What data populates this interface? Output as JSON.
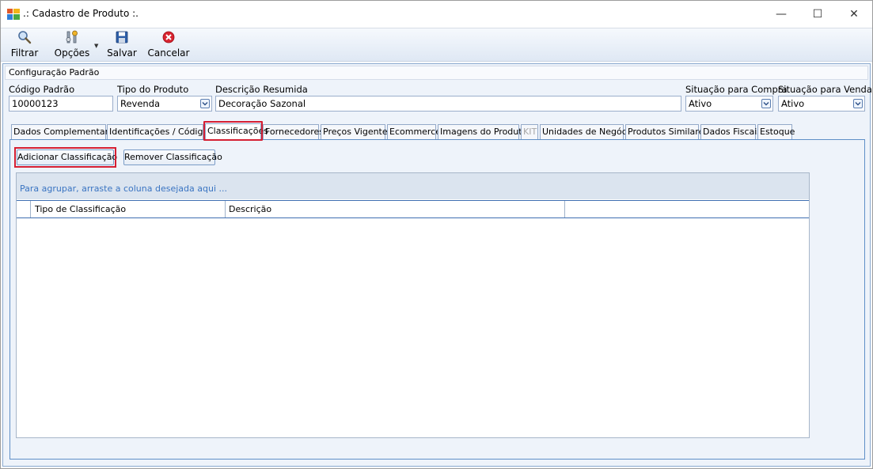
{
  "window": {
    "title": ".: Cadastro de Produto :.",
    "minimize_glyph": "—",
    "maximize_glyph": "☐",
    "close_glyph": "✕"
  },
  "toolbar": {
    "filtrar": "Filtrar",
    "opcoes": "Opções",
    "salvar": "Salvar",
    "cancelar": "Cancelar"
  },
  "config": {
    "header": "Configuração Padrão",
    "codigo_label": "Código Padrão",
    "codigo_value": "10000123",
    "tipo_label": "Tipo do Produto",
    "tipo_value": "Revenda",
    "descricao_label": "Descrição Resumida",
    "descricao_value": "Decoração Sazonal",
    "sit_compra_label": "Situação para Compra",
    "sit_compra_value": "Ativo",
    "sit_venda_label": "Situação para Venda",
    "sit_venda_value": "Ativo"
  },
  "tabs": [
    {
      "label": "Dados Complementares"
    },
    {
      "label": "Identificações / Códigos"
    },
    {
      "label": "Classificações"
    },
    {
      "label": "Fornecedores"
    },
    {
      "label": "Preços Vigentes"
    },
    {
      "label": "Ecommerce"
    },
    {
      "label": "Imagens do Produto"
    },
    {
      "label": "KIT"
    },
    {
      "label": "Unidades de Negócio"
    },
    {
      "label": "Produtos Similares"
    },
    {
      "label": "Dados Fiscais"
    },
    {
      "label": "Estoque"
    }
  ],
  "classificacoes": {
    "add_button": "Adicionar Classificação",
    "remove_button": "Remover Classificação",
    "group_hint": "Para agrupar, arraste a coluna desejada aqui ...",
    "columns": [
      "Tipo de Classificação",
      "Descrição",
      ""
    ]
  },
  "colors": {
    "highlight": "#d51f33",
    "panel_border": "#5f8fc7",
    "group_hint_text": "#3a74c2"
  },
  "icons": {
    "filtrar": "magnifier-icon",
    "opcoes": "tools-icon",
    "salvar": "floppy-disk-icon",
    "cancelar": "red-x-circle-icon"
  }
}
